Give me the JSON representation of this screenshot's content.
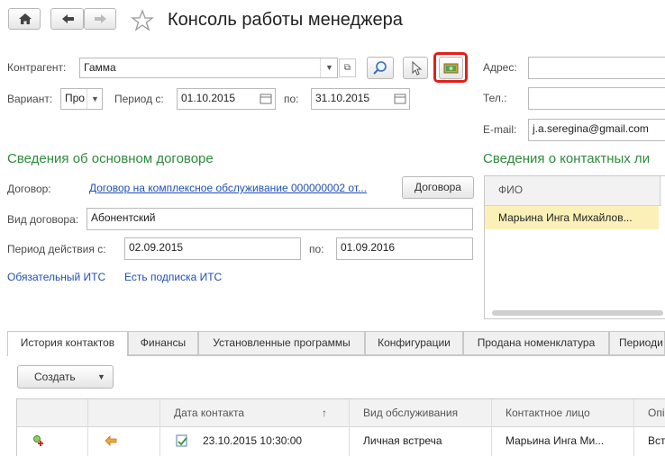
{
  "title": "Консоль работы менеджера",
  "form": {
    "contragent_label": "Контрагент:",
    "contragent_value": "Гамма",
    "variant_label": "Вариант:",
    "variant_value": "Про",
    "period_from_label": "Период с:",
    "period_from": "01.10.2015",
    "period_to_label": "по:",
    "period_to": "31.10.2015"
  },
  "right": {
    "address_label": "Адрес:",
    "address_value": "",
    "phone_label": "Тел.:",
    "phone_value": "",
    "email_label": "E-mail:",
    "email_value": "j.a.seregina@gmail.com",
    "contacts_heading": "Сведения о контактных ли",
    "contacts_col": "ФИО",
    "contacts_rows": [
      "Марьина Инга Михайлов..."
    ]
  },
  "contract": {
    "heading": "Сведения об основном договоре",
    "contract_label": "Договор:",
    "contract_link": "Договор на комплексное обслуживание 000000002 от...",
    "contracts_button": "Договора",
    "type_label": "Вид договора:",
    "type_value": "Абонентский",
    "validity_label": "Период действия с:",
    "validity_from": "02.09.2015",
    "validity_to_label": "по:",
    "validity_to": "01.09.2016",
    "its_required": "Обязательный ИТС",
    "its_subscription": "Есть подписка ИТС"
  },
  "tabs": [
    "История контактов",
    "Финансы",
    "Установленные программы",
    "Конфигурации",
    "Продана номенклатура",
    "Периоди"
  ],
  "history": {
    "create_button": "Создать",
    "columns": [
      "Дата контакта",
      "Вид обслуживания",
      "Контактное лицо",
      "Опі"
    ],
    "sort_indicator": "↑",
    "rows": [
      {
        "date": "23.10.2015 10:30:00",
        "service": "Личная встреча",
        "contact": "Марьина Инга Ми...",
        "extra": "Вст"
      }
    ]
  },
  "colors": {
    "accent_green": "#2e8b3a",
    "link_blue": "#1f4fb5",
    "highlight": "#e0201b",
    "selected_row": "#fbf1b8"
  }
}
